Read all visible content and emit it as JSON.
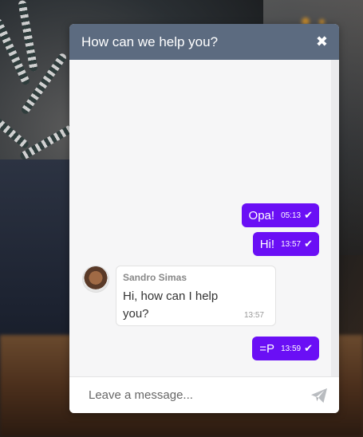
{
  "header": {
    "title": "How can we help you?",
    "close_icon": "close-icon"
  },
  "messages": [
    {
      "direction": "out",
      "text": "Opa!",
      "time": "05:13",
      "status_icon": "check-icon"
    },
    {
      "direction": "out",
      "text": "Hi!",
      "time": "13:57",
      "status_icon": "check-icon"
    },
    {
      "direction": "in",
      "sender": "Sandro Simas",
      "text": "Hi, how can I help you?",
      "time": "13:57"
    },
    {
      "direction": "out",
      "text": "=P",
      "time": "13:59",
      "status_icon": "check-icon"
    }
  ],
  "footer": {
    "placeholder": "Leave a message...",
    "send_icon": "send-icon"
  },
  "colors": {
    "header": "#5c6b80",
    "outgoing_bubble": "#6a0ff5",
    "background": "#f6f6f7"
  }
}
